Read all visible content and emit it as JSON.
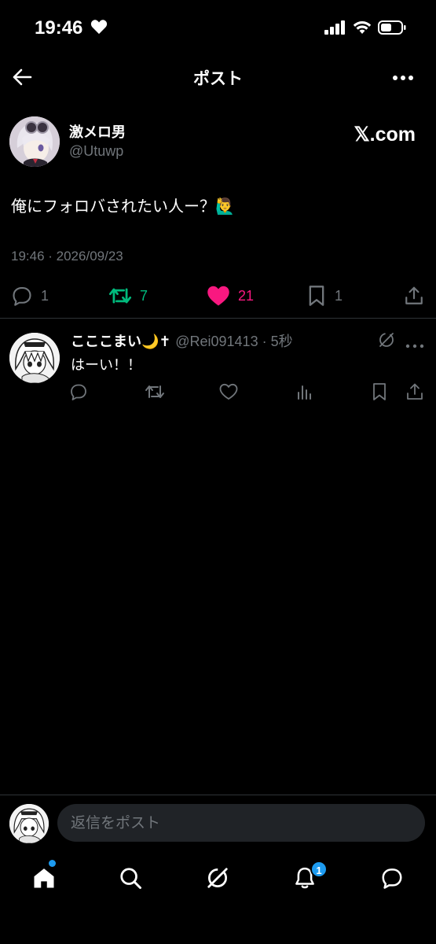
{
  "status_bar": {
    "time": "19:46"
  },
  "header": {
    "title": "ポスト"
  },
  "post": {
    "display_name": "激メロ男",
    "handle": "@Utuwp",
    "source_badge": "𝕏.com",
    "text": "俺にフォロバされたい人ー？🙋‍♂️",
    "timestamp": "19:46 · 2026/09/23",
    "stats": {
      "replies": "1",
      "reposts": "7",
      "likes": "21",
      "bookmarks": "1"
    },
    "colors": {
      "repost": "#00ba7c",
      "like": "#f91880",
      "muted": "#71767b"
    }
  },
  "reply": {
    "display_name": "こここまい🌙✝",
    "handle": "@Rei091413",
    "time": "5秒",
    "text": "はーい！！"
  },
  "composer": {
    "placeholder": "返信をポスト"
  },
  "tabbar": {
    "notifications_badge": "1",
    "accent": "#1d9bf0"
  }
}
